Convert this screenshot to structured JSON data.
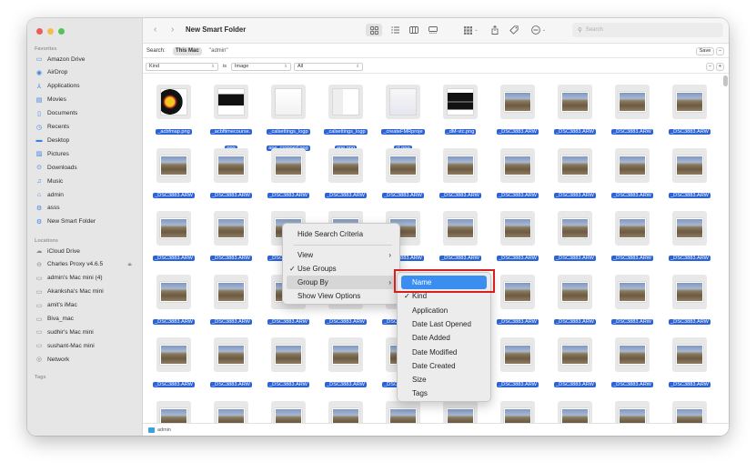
{
  "window": {
    "title": "New Smart Folder"
  },
  "sidebar": {
    "favorites_header": "Favorites",
    "favorites": [
      {
        "label": "Amazon Drive",
        "icon": "folder-icon"
      },
      {
        "label": "AirDrop",
        "icon": "airdrop-icon"
      },
      {
        "label": "Applications",
        "icon": "applications-icon"
      },
      {
        "label": "Movies",
        "icon": "movies-icon"
      },
      {
        "label": "Documents",
        "icon": "document-icon"
      },
      {
        "label": "Recents",
        "icon": "clock-icon"
      },
      {
        "label": "Desktop",
        "icon": "desktop-icon"
      },
      {
        "label": "Pictures",
        "icon": "pictures-icon"
      },
      {
        "label": "Downloads",
        "icon": "download-icon"
      },
      {
        "label": "Music",
        "icon": "music-icon"
      },
      {
        "label": "admin",
        "icon": "home-icon"
      },
      {
        "label": "asss",
        "icon": "smart-folder-icon"
      },
      {
        "label": "New Smart Folder",
        "icon": "smart-folder-icon"
      }
    ],
    "locations_header": "Locations",
    "locations": [
      {
        "label": "iCloud Drive",
        "icon": "cloud-icon"
      },
      {
        "label": "Charles Proxy v4.6.5",
        "icon": "disk-icon",
        "eject": true
      },
      {
        "label": "admin's Mac mini (4)",
        "icon": "mac-mini-icon"
      },
      {
        "label": "Akanksha's Mac mini",
        "icon": "mac-mini-icon"
      },
      {
        "label": "amit's iMac",
        "icon": "imac-icon"
      },
      {
        "label": "Biva_mac",
        "icon": "mac-mini-icon"
      },
      {
        "label": "sudhir's Mac mini",
        "icon": "mac-mini-icon"
      },
      {
        "label": "sushant-Mac mini",
        "icon": "mac-mini-icon"
      },
      {
        "label": "Network",
        "icon": "network-icon"
      }
    ],
    "tags_header": "Tags"
  },
  "toolbar": {
    "back": "‹",
    "forward": "›",
    "search_placeholder": "Search"
  },
  "searchbar": {
    "label": "Search:",
    "scope_selected": "This Mac",
    "scope_other": "\"admin\"",
    "save_label": "Save",
    "remove_label": "−"
  },
  "criteria": {
    "attribute": "Kind",
    "operator": "is",
    "value": "Image",
    "subvalue": "All",
    "remove_label": "−",
    "add_label": "+"
  },
  "files": [
    {
      "name": "_acbfmap.png",
      "type": "screenshot"
    },
    {
      "name": "_acbftimecourse.png",
      "type": "screenshot"
    },
    {
      "name": "_calsettings_logpane_cropped.png",
      "type": "screenshot"
    },
    {
      "name": "_calsettings_logpane.png",
      "type": "screenshot"
    },
    {
      "name": "_createFMRproject.png",
      "type": "screenshot"
    },
    {
      "name": "_dM-vtc.png",
      "type": "screenshot"
    },
    {
      "name": "_DSC3883.ARW",
      "type": "photo"
    },
    {
      "name": "_DSC3883.ARW",
      "type": "photo"
    },
    {
      "name": "_DSC3883.ARW",
      "type": "photo"
    },
    {
      "name": "_DSC3883.ARW",
      "type": "photo"
    }
  ],
  "repeat_file_name": "_DSC3883.ARW",
  "label_lines": {
    "_acbftimecourse.png": [
      "_acbftimecourse.",
      "png"
    ],
    "_calsettings_logpane_cropped.png": [
      "_calsettings_logp",
      "ane_cropped.png"
    ],
    "_calsettings_logpane.png": [
      "_calsettings_logp",
      "ane.png"
    ],
    "_createFMRproject.png": [
      "_createFMRproje",
      "ct.png"
    ]
  },
  "pathbar": {
    "folder": "admin"
  },
  "context_menu": {
    "items": [
      {
        "label": "Hide Search Criteria"
      },
      {
        "label": "View",
        "submenu": true
      },
      {
        "label": "Use Groups",
        "checked": true
      },
      {
        "label": "Group By",
        "submenu": true,
        "hover": true
      },
      {
        "label": "Show View Options"
      }
    ]
  },
  "group_by_menu": {
    "items": [
      {
        "label": "Name",
        "selected": true
      },
      {
        "label": "Kind",
        "checked": true
      },
      {
        "label": "Application"
      },
      {
        "label": "Date Last Opened"
      },
      {
        "label": "Date Added"
      },
      {
        "label": "Date Modified"
      },
      {
        "label": "Date Created"
      },
      {
        "label": "Size"
      },
      {
        "label": "Tags"
      }
    ]
  },
  "colors": {
    "selection": "#2c64d8",
    "menu_highlight": "#3a8ef0",
    "annotation_box": "#d42020"
  }
}
